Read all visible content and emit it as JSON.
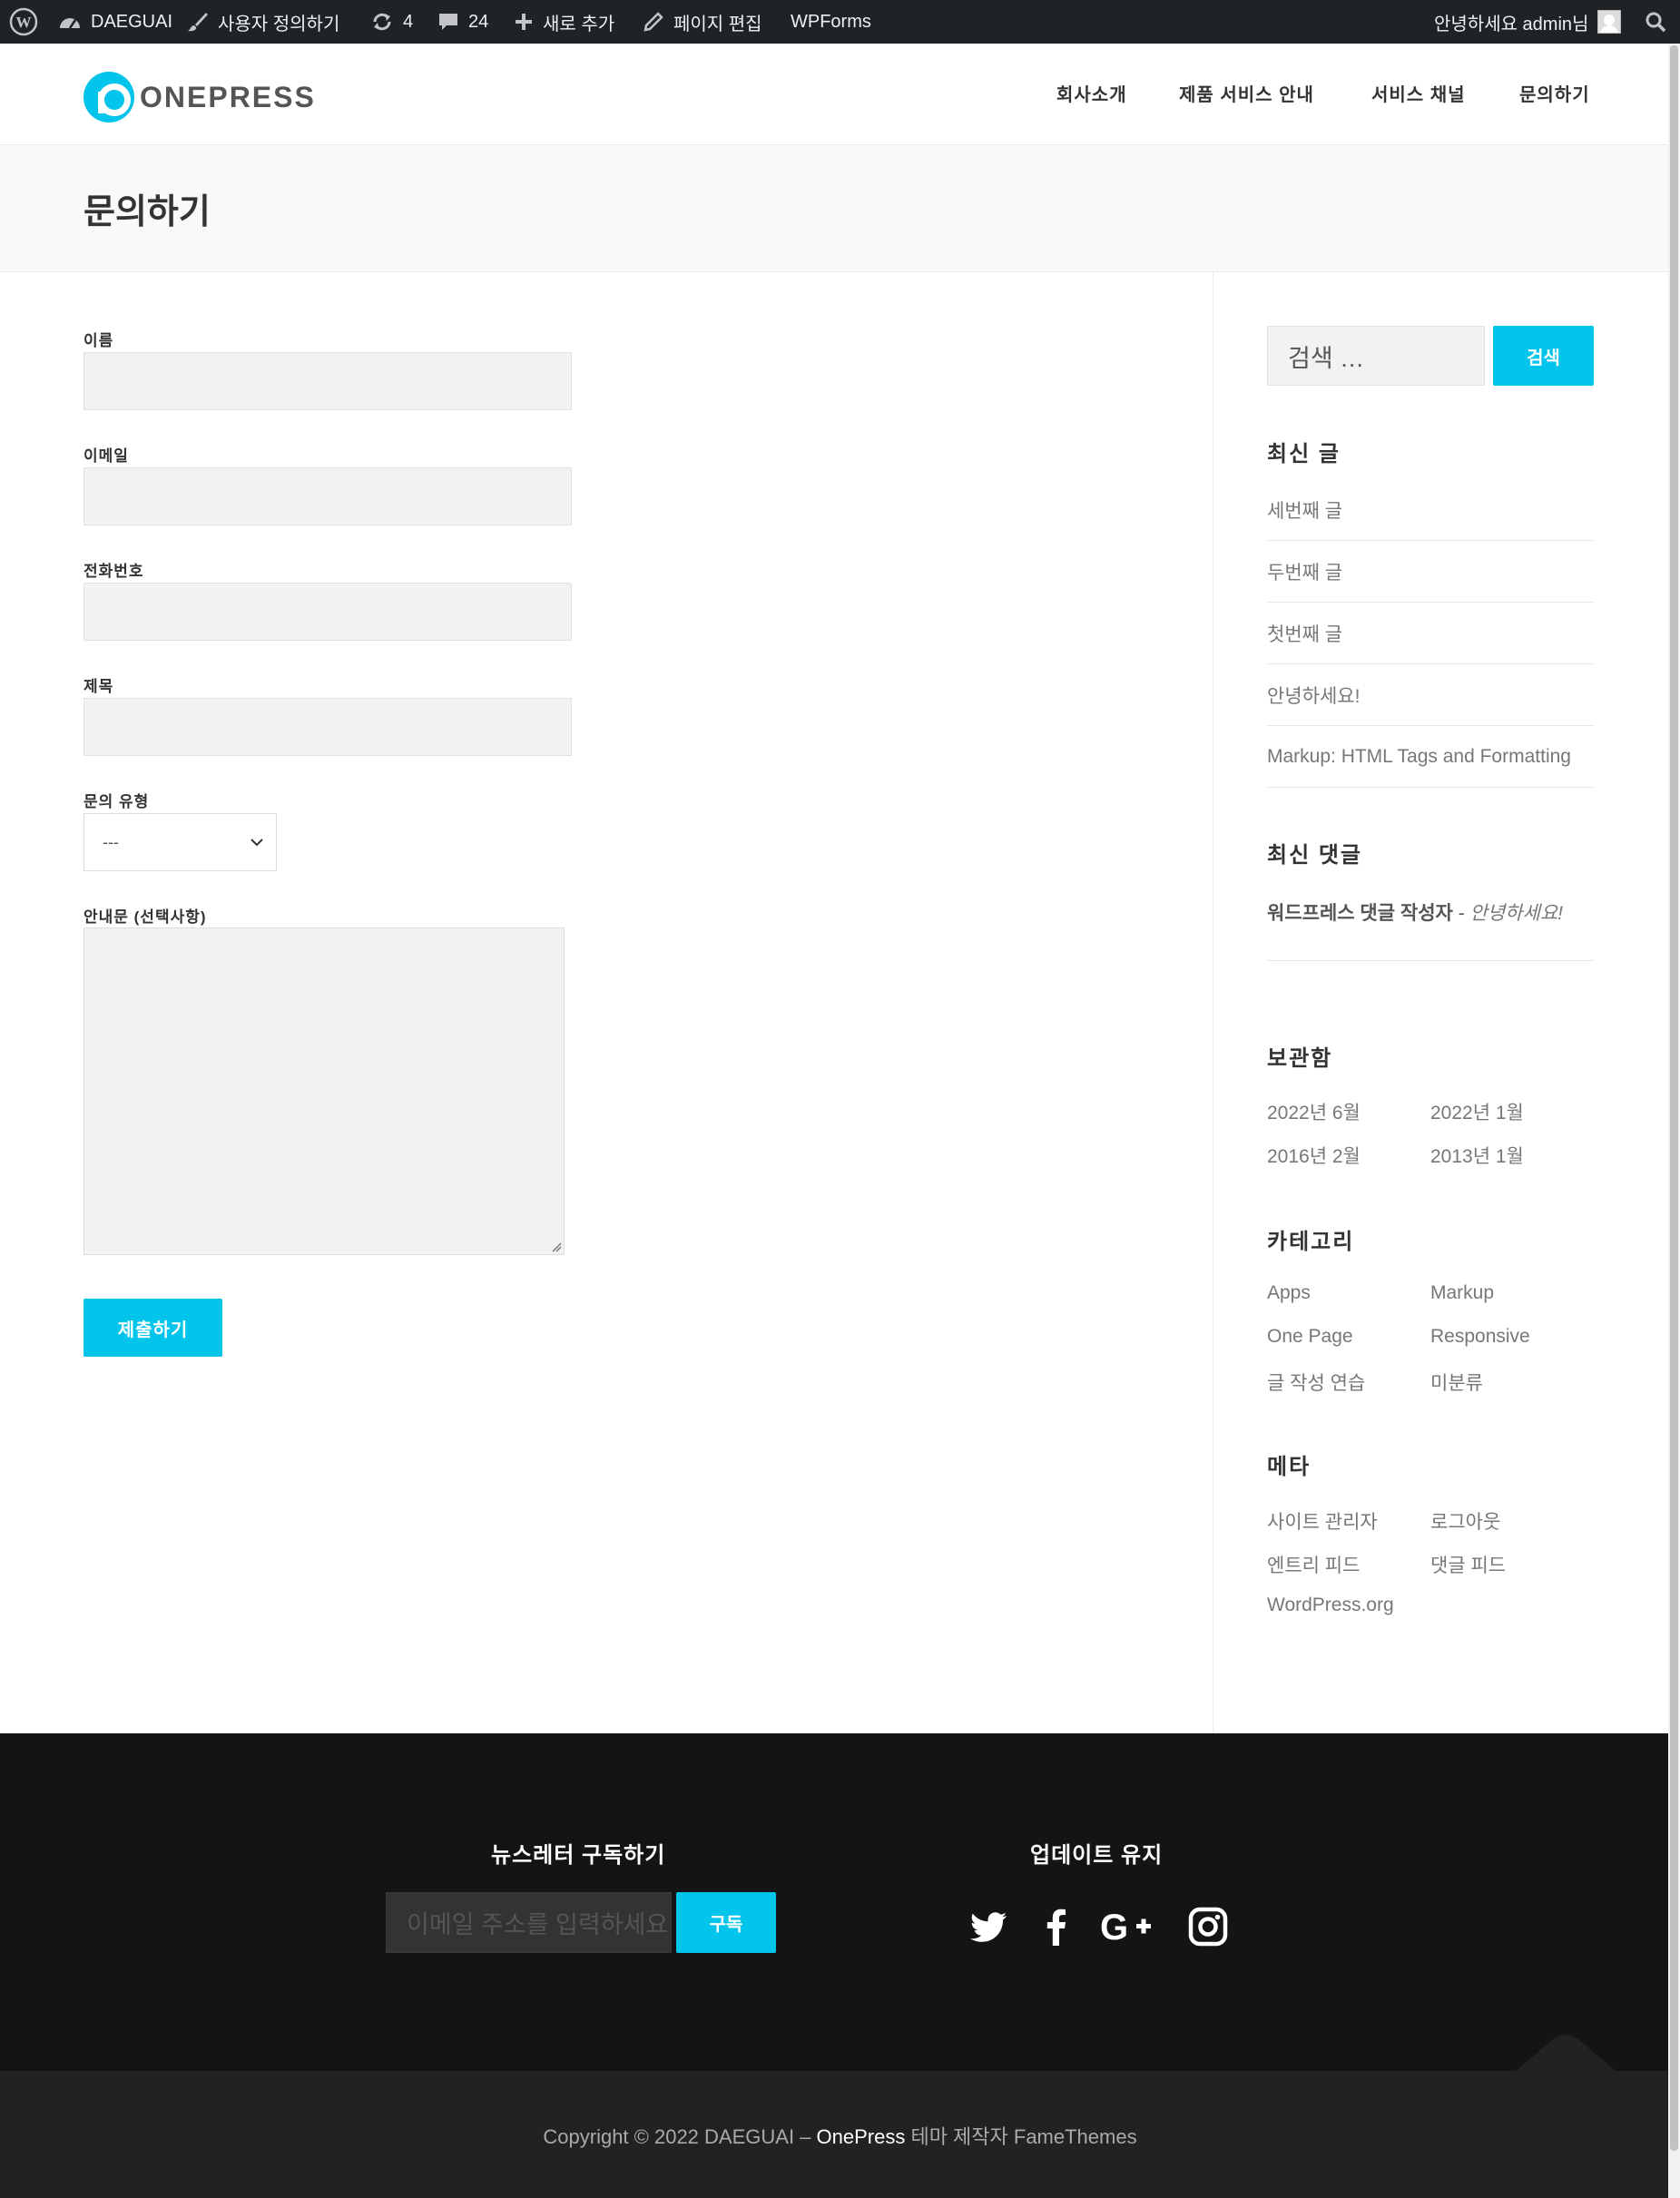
{
  "admin_bar": {
    "site_name": "DAEGUAI",
    "customize": "사용자 정의하기",
    "updates_count": "4",
    "comments_count": "24",
    "new_label": "새로 추가",
    "edit_page": "페이지 편집",
    "wpforms": "WPForms",
    "greeting": "안녕하세요 admin님"
  },
  "header": {
    "logo_text": "ONEPRESS",
    "nav": [
      "회사소개",
      "제품 서비스 안내",
      "서비스 채널",
      "문의하기"
    ]
  },
  "page_title": "문의하기",
  "form": {
    "name_label": "이름",
    "email_label": "이메일",
    "phone_label": "전화번호",
    "subject_label": "제목",
    "type_label": "문의 유형",
    "type_selected": "---",
    "message_label": "안내문 (선택사항)",
    "submit_label": "제출하기"
  },
  "sidebar": {
    "search_placeholder": "검색 …",
    "search_button": "검색",
    "recent_posts_title": "최신 글",
    "recent_posts": [
      "세번째 글",
      "두번째 글",
      "첫번째 글",
      "안녕하세요!",
      "Markup: HTML Tags and Formatting"
    ],
    "recent_comments_title": "최신 댓글",
    "comment_author": "워드프레스 댓글 작성자",
    "comment_sep": " - ",
    "comment_post": "안녕하세요!",
    "archives_title": "보관함",
    "archives": [
      "2022년 6월",
      "2022년 1월",
      "2016년 2월",
      "2013년 1월"
    ],
    "categories_title": "카테고리",
    "categories": [
      "Apps",
      "Markup",
      "One Page",
      "Responsive",
      "글 작성 연습",
      "미분류"
    ],
    "meta_title": "메타",
    "meta": [
      "사이트 관리자",
      "로그아웃",
      "엔트리 피드",
      "댓글 피드",
      "WordPress.org"
    ]
  },
  "footer": {
    "newsletter_title": "뉴스레터 구독하기",
    "email_placeholder": "이메일 주소를 입력하세요",
    "subscribe_button": "구독",
    "updates_title": "업데이트 유지",
    "social_icons": [
      "twitter-icon",
      "facebook-icon",
      "google-plus-icon",
      "instagram-icon"
    ],
    "copyright_prefix": "Copyright © 2022 DAEGUAI – ",
    "copyright_theme": "OnePress",
    "copyright_suffix": " 테마 제작자 FameThemes"
  },
  "colors": {
    "accent": "#03c4eb",
    "admin_bar": "#1d2327",
    "footer": "#141414",
    "bottom_bar": "#222222"
  }
}
